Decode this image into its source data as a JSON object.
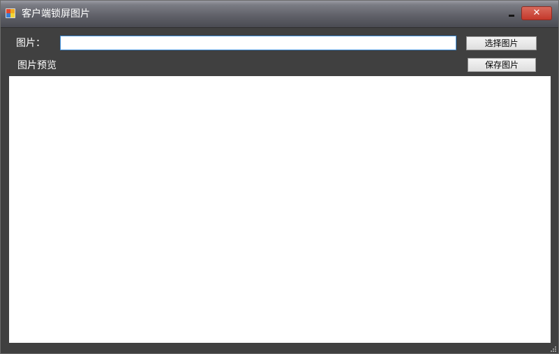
{
  "window": {
    "title": "客户端锁屏图片",
    "app_icon": "windows-form-icon",
    "minimize_icon": "minimize-icon",
    "close_icon": "close-icon",
    "close_color": "#c4382b"
  },
  "form": {
    "image_label": "图片：",
    "image_path_value": "",
    "select_button_label": "选择图片",
    "preview_label": "图片预览",
    "save_button_label": "保存图片",
    "input_border_color": "#3d8cd6"
  }
}
